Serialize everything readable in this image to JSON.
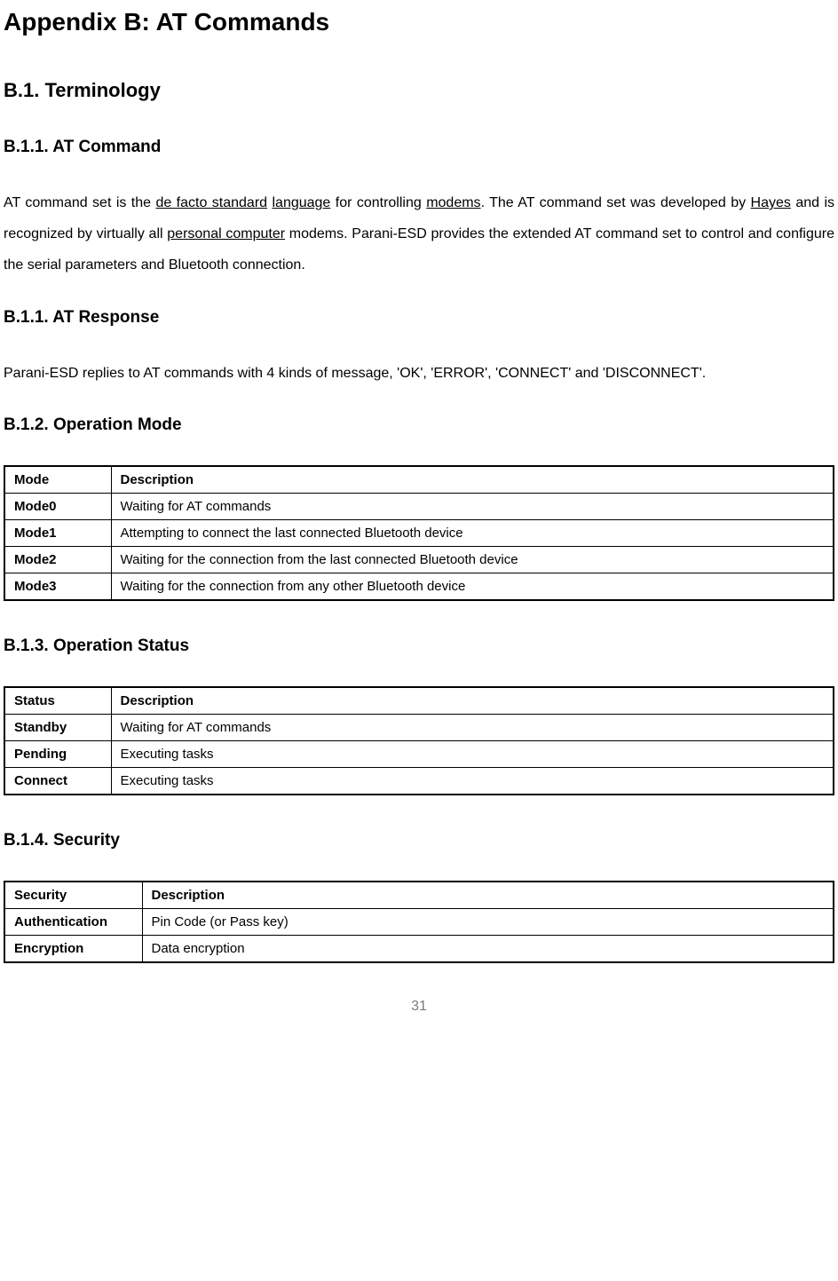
{
  "title": "Appendix B: AT Commands",
  "section1": {
    "heading": "B.1. Terminology",
    "sub1": {
      "heading": "B.1.1. AT Command",
      "para_pre": "AT command set is the ",
      "link1": "de facto standard",
      "space1": " ",
      "link2": "language",
      "para_mid1": " for controlling ",
      "link3": "modems",
      "para_mid2": ". The AT command set was developed by ",
      "link4": "Hayes",
      "para_mid3": " and is recognized by virtually all ",
      "link5": "personal computer",
      "para_post": " modems. Parani-ESD provides the extended AT command set to control and configure the serial parameters and Bluetooth connection."
    },
    "sub2": {
      "heading": "B.1.1. AT Response",
      "para": "Parani-ESD replies to AT commands with 4 kinds of message, 'OK', 'ERROR', 'CONNECT' and 'DISCONNECT'."
    },
    "sub3": {
      "heading": "B.1.2. Operation Mode",
      "table": {
        "headers": [
          "Mode",
          "Description"
        ],
        "rows": [
          [
            "Mode0",
            "Waiting for AT commands"
          ],
          [
            "Mode1",
            "Attempting to connect the last connected Bluetooth device"
          ],
          [
            "Mode2",
            "Waiting for the connection from the last connected Bluetooth device"
          ],
          [
            "Mode3",
            "Waiting for the connection from any other Bluetooth device"
          ]
        ]
      }
    },
    "sub4": {
      "heading": "B.1.3. Operation Status",
      "table": {
        "headers": [
          "Status",
          "Description"
        ],
        "rows": [
          [
            "Standby",
            "Waiting for AT commands"
          ],
          [
            "Pending",
            "Executing tasks"
          ],
          [
            "Connect",
            "Executing tasks"
          ]
        ]
      }
    },
    "sub5": {
      "heading": "B.1.4. Security",
      "table": {
        "headers": [
          "Security",
          "Description"
        ],
        "rows": [
          [
            "Authentication",
            "Pin Code (or Pass key)"
          ],
          [
            "Encryption",
            "Data encryption"
          ]
        ]
      }
    }
  },
  "page_number": "31"
}
